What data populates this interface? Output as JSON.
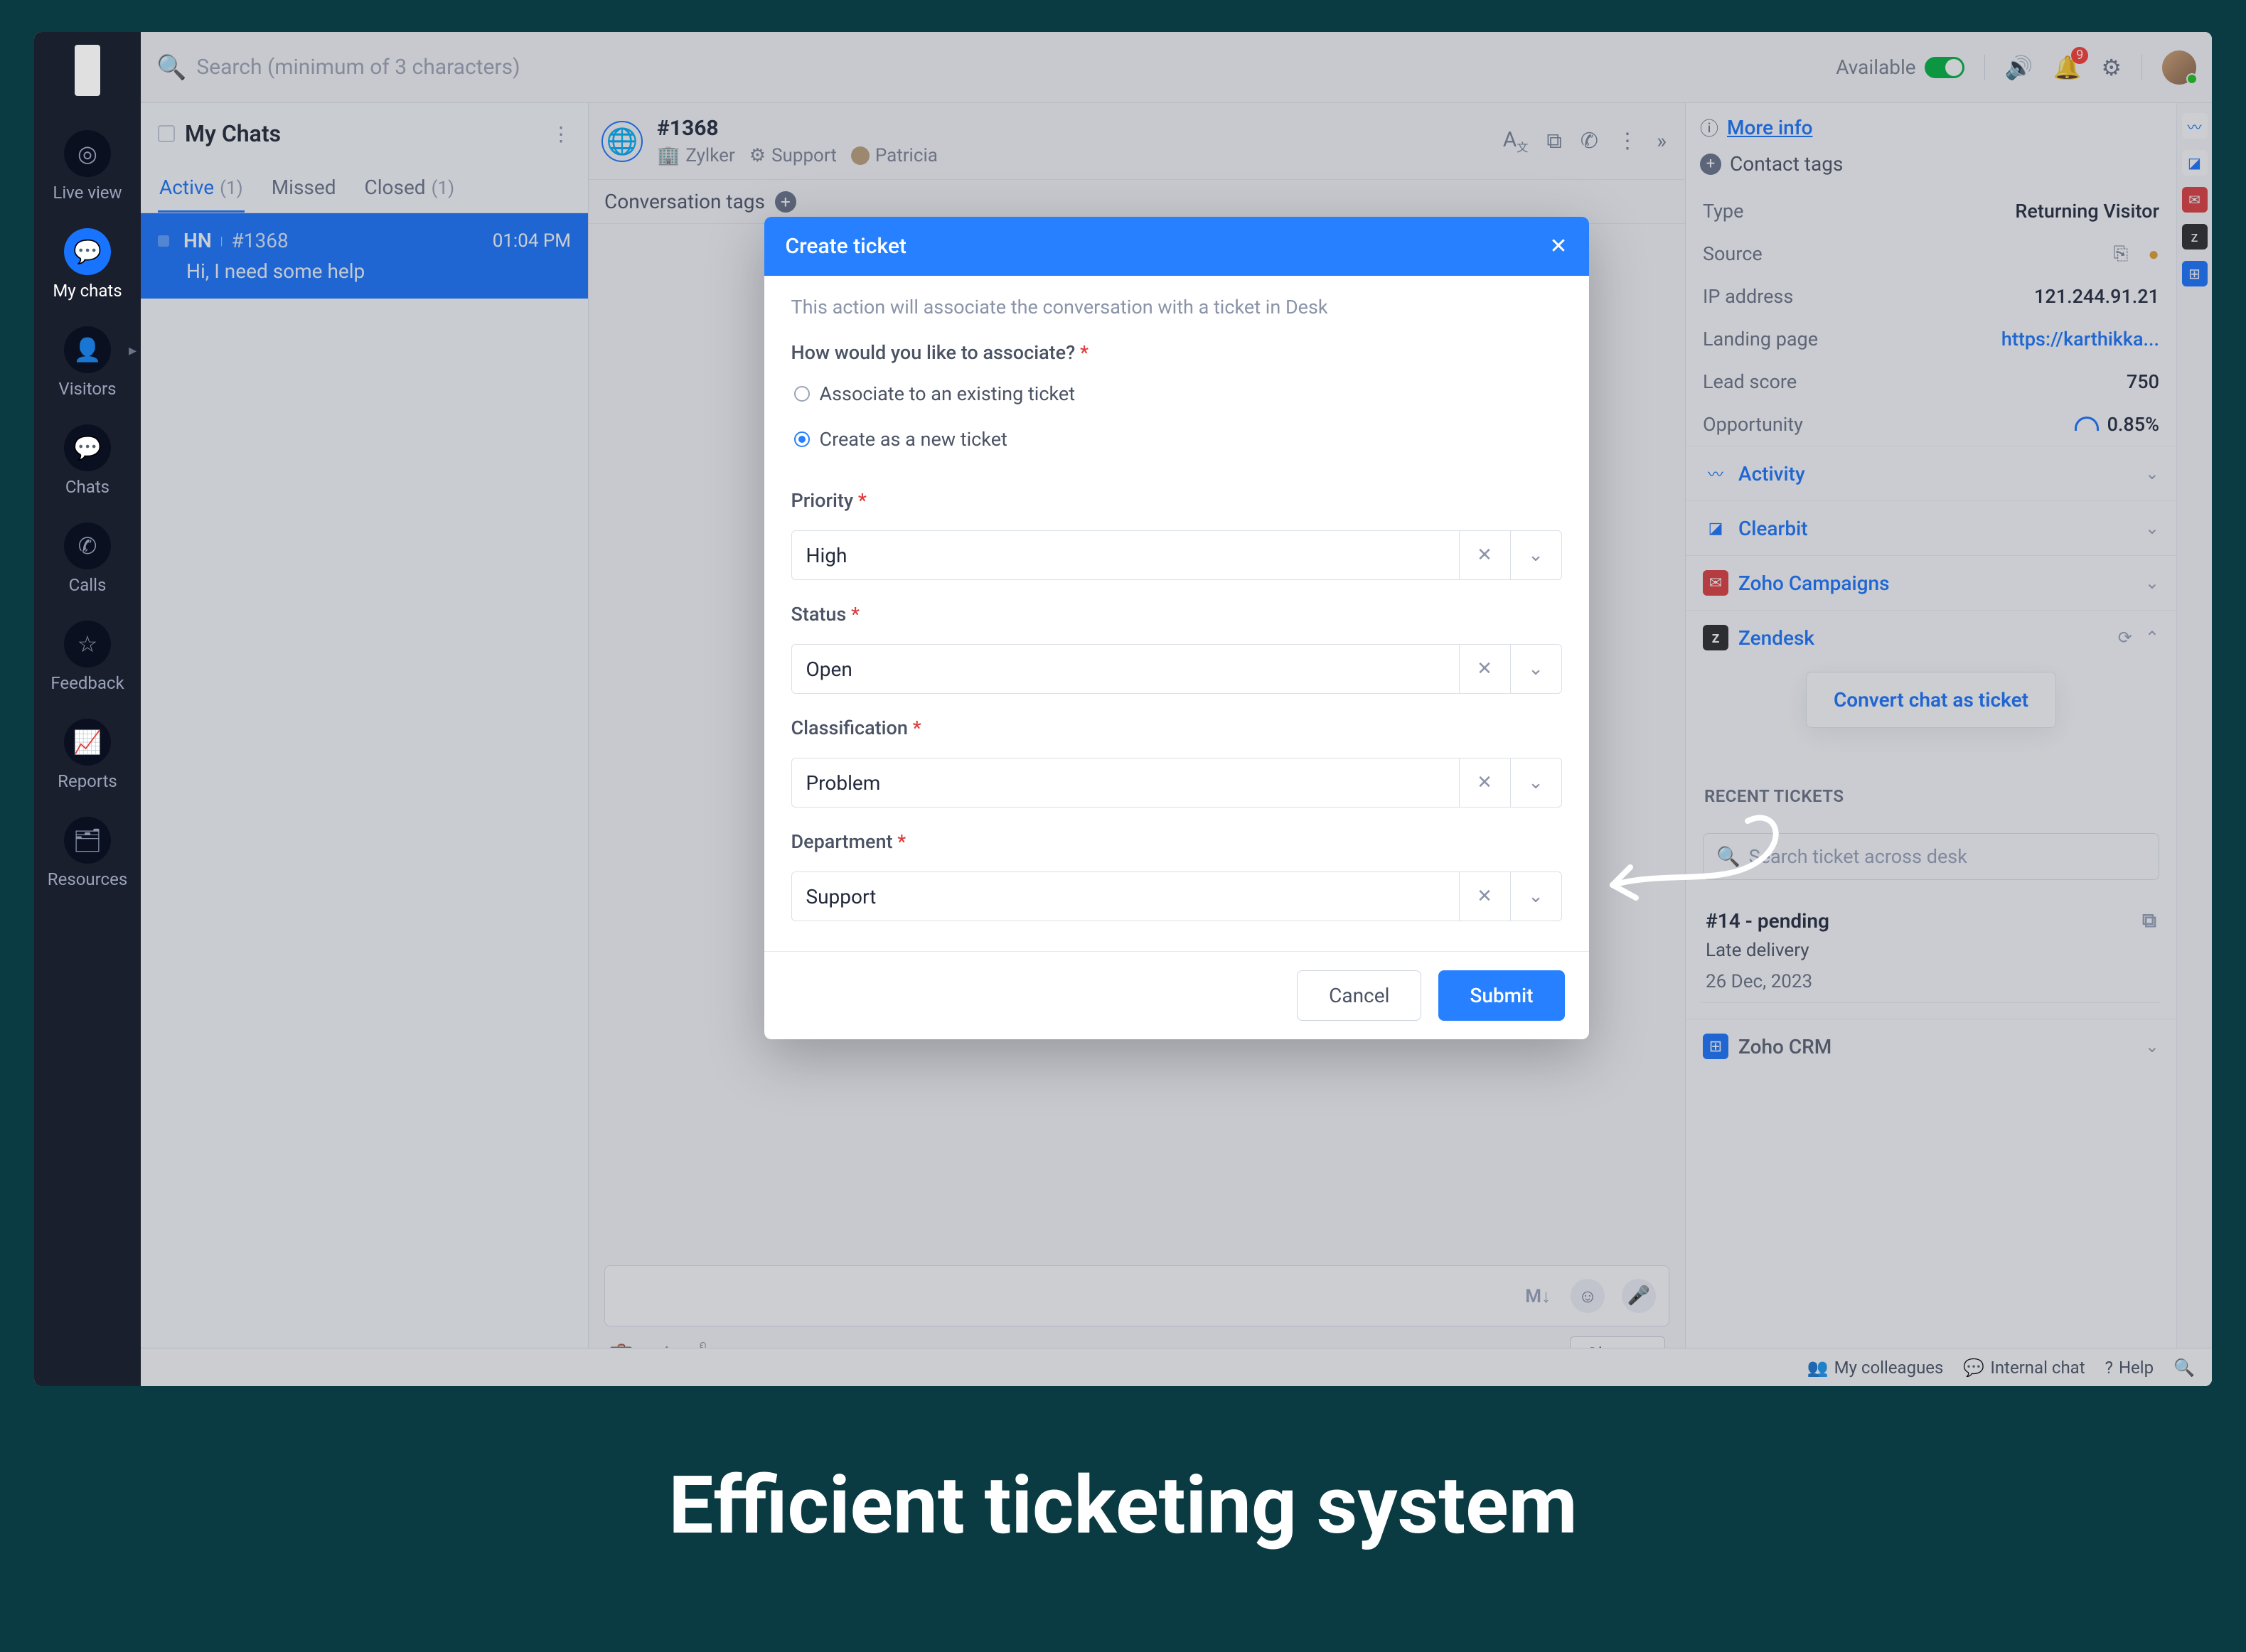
{
  "caption": "Efficient ticketing system",
  "topbar": {
    "search_placeholder": "Search (minimum of 3 characters)",
    "availability": "Available",
    "notification_count": "9"
  },
  "rail": {
    "items": [
      {
        "label": "Live view"
      },
      {
        "label": "My chats"
      },
      {
        "label": "Visitors"
      },
      {
        "label": "Chats"
      },
      {
        "label": "Calls"
      },
      {
        "label": "Feedback"
      },
      {
        "label": "Reports"
      },
      {
        "label": "Resources"
      }
    ]
  },
  "chats_panel": {
    "title": "My Chats",
    "tabs": {
      "active_label": "Active",
      "active_count": "(1)",
      "missed_label": "Missed",
      "closed_label": "Closed",
      "closed_count": "(1)"
    },
    "row": {
      "initials": "HN",
      "id": "#1368",
      "time": "01:04 PM",
      "preview": "Hi, I need some help"
    }
  },
  "conversation": {
    "id": "#1368",
    "org": "Zylker",
    "team": "Support",
    "agent": "Patricia",
    "tags_label": "Conversation tags",
    "markdown_label": "M↓",
    "close_label": "Close"
  },
  "info_panel": {
    "more_info": "More info",
    "contact_tags": "Contact tags",
    "rows": {
      "type_label": "Type",
      "type_val": "Returning Visitor",
      "source_label": "Source",
      "ip_label": "IP address",
      "ip_val": "121.244.91.21",
      "landing_label": "Landing page",
      "landing_val": "https://karthikka...",
      "lead_label": "Lead score",
      "lead_val": "750",
      "opp_label": "Opportunity",
      "opp_val": "0.85%"
    },
    "accordions": {
      "activity": "Activity",
      "clearbit": "Clearbit",
      "zoho_campaigns": "Zoho Campaigns",
      "zendesk": "Zendesk",
      "zoho_crm": "Zoho CRM"
    },
    "zendesk": {
      "convert_btn": "Convert chat as ticket",
      "recent_title": "RECENT TICKETS",
      "search_placeholder": "Search ticket across desk",
      "ticket_title": "#14 - pending",
      "ticket_subject": "Late delivery",
      "ticket_date": "26 Dec, 2023"
    }
  },
  "status_bar": {
    "colleagues": "My colleagues",
    "internal_chat": "Internal chat",
    "help": "Help"
  },
  "modal": {
    "title": "Create ticket",
    "hint": "This action will associate the conversation with a ticket in Desk",
    "question": "How would you like to associate?",
    "opt_existing": "Associate to an existing ticket",
    "opt_new": "Create as a new ticket",
    "priority_label": "Priority",
    "priority_val": "High",
    "status_label": "Status",
    "status_val": "Open",
    "classification_label": "Classification",
    "classification_val": "Problem",
    "department_label": "Department",
    "department_val": "Support",
    "cancel": "Cancel",
    "submit": "Submit"
  }
}
